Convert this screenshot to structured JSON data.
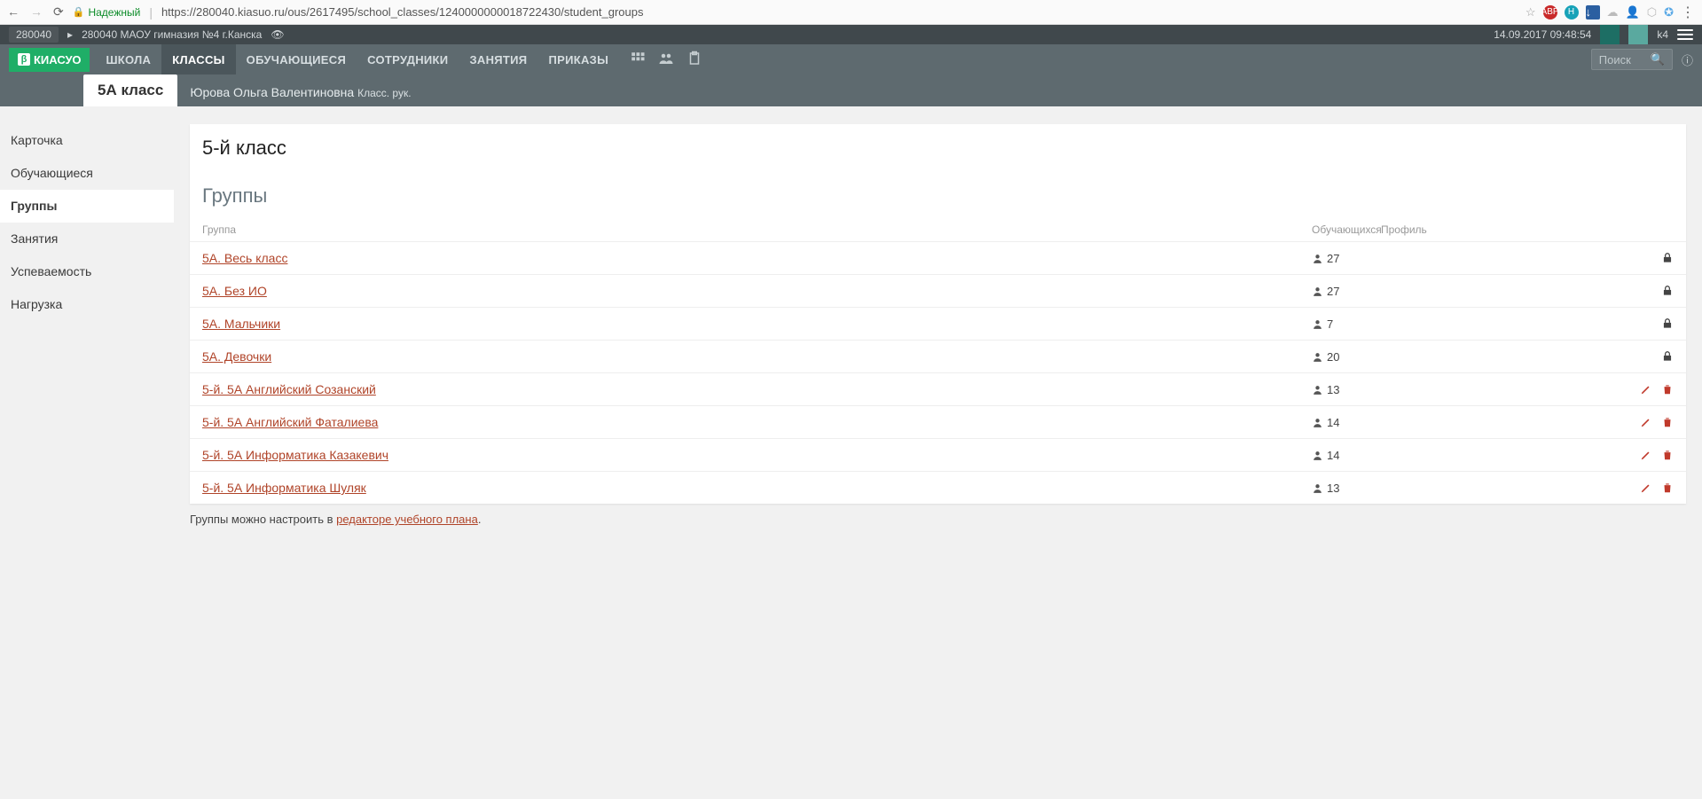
{
  "browser": {
    "secure_label": "Надежный",
    "url": "https://280040.kiasuo.ru/ous/2617495/school_classes/1240000000018722430/student_groups"
  },
  "top_strip": {
    "code": "280040",
    "school": "280040 МАОУ гимназия №4 г.Канска",
    "datetime": "14.09.2017 09:48:54",
    "user": "k4"
  },
  "logo": {
    "beta": "β",
    "name": "КИАСУО"
  },
  "nav": {
    "school": "ШКОЛА",
    "classes": "КЛАССЫ",
    "students": "ОБУЧАЮЩИЕСЯ",
    "staff": "СОТРУДНИКИ",
    "lessons": "ЗАНЯТИЯ",
    "orders": "ПРИКАЗЫ"
  },
  "search_placeholder": "Поиск",
  "class_tab": "5А класс",
  "teacher_name": "Юрова Ольга Валентиновна",
  "teacher_role": "Класс. рук.",
  "sidebar": {
    "card": "Карточка",
    "students": "Обучающиеся",
    "groups": "Группы",
    "lessons": "Занятия",
    "progress": "Успеваемость",
    "workload": "Нагрузка"
  },
  "page_title": "5-й класс",
  "section_title": "Группы",
  "table_head": {
    "group": "Группа",
    "count": "Обучающихся",
    "profile": "Профиль"
  },
  "rows": [
    {
      "name": "5А. Весь класс",
      "count": "27",
      "locked": true
    },
    {
      "name": "5А. Без ИО",
      "count": "27",
      "locked": true
    },
    {
      "name": "5А. Мальчики",
      "count": "7",
      "locked": true
    },
    {
      "name": "5А. Девочки",
      "count": "20",
      "locked": true
    },
    {
      "name": "5-й. 5А Английский Созанский",
      "count": "13",
      "locked": false
    },
    {
      "name": "5-й. 5А Английский Фаталиева",
      "count": "14",
      "locked": false
    },
    {
      "name": "5-й. 5А Информатика Казакевич",
      "count": "14",
      "locked": false
    },
    {
      "name": "5-й. 5А Информатика Шуляк",
      "count": "13",
      "locked": false
    }
  ],
  "footer_note_prefix": "Группы можно настроить в ",
  "footer_note_link": "редакторе учебного плана"
}
